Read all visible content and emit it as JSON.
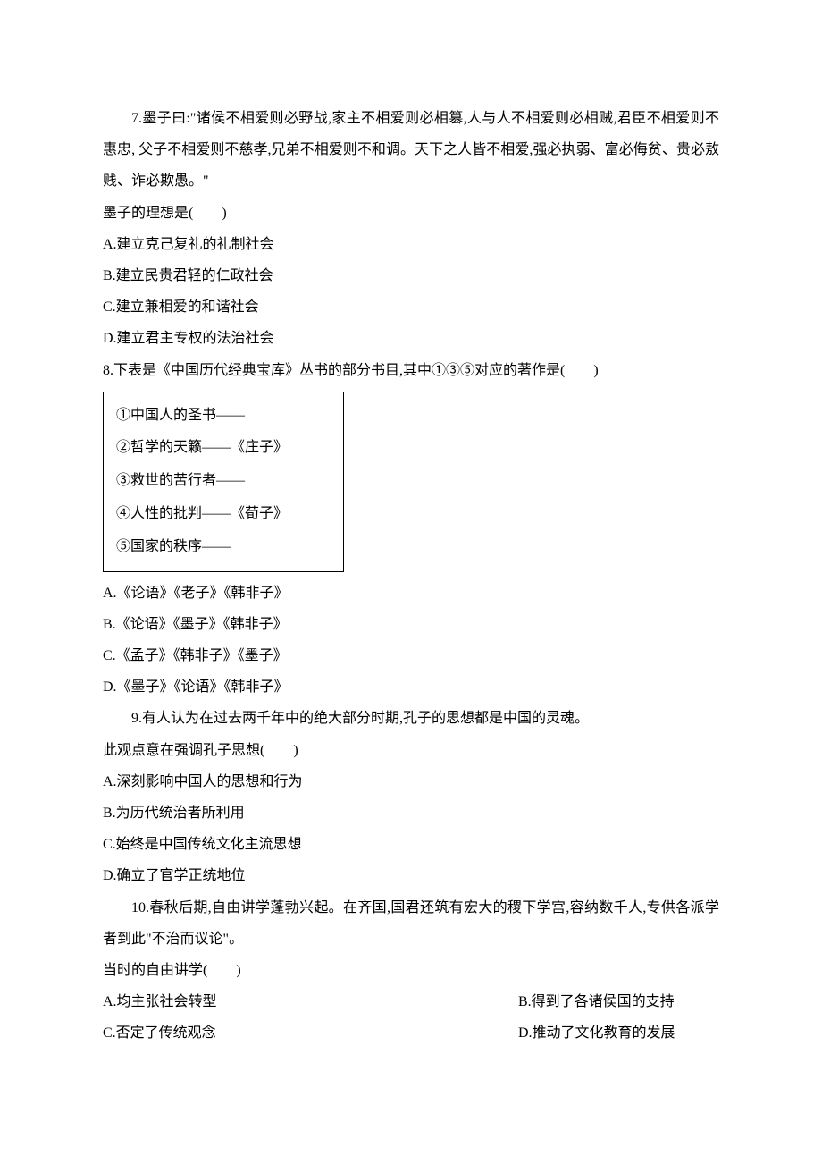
{
  "q7": {
    "text": "7.墨子曰:\"诸侯不相爱则必野战,家主不相爱则必相篡,人与人不相爱则必相贼,君臣不相爱则不惠忠, 父子不相爱则不慈孝,兄弟不相爱则不和调。天下之人皆不相爱,强必执弱、富必侮贫、贵必敖贱、诈必欺愚。\"",
    "stem": "墨子的理想是(　　)",
    "A": "A.建立克己复礼的礼制社会",
    "B": "B.建立民贵君轻的仁政社会",
    "C": "C.建立兼相爱的和谐社会",
    "D": "D.建立君主专权的法治社会"
  },
  "q8": {
    "text": "8.下表是《中国历代经典宝库》丛书的部分书目,其中①③⑤对应的著作是(　　)",
    "box": {
      "l1": "①中国人的圣书——",
      "l2": "②哲学的天籁——《庄子》",
      "l3": "③救世的苦行者——",
      "l4": "④人性的批判——《荀子》",
      "l5": "⑤国家的秩序——"
    },
    "A": "A.《论语》《老子》《韩非子》",
    "B": "B.《论语》《墨子》《韩非子》",
    "C": "C.《孟子》《韩非子》《墨子》",
    "D": "D.《墨子》《论语》《韩非子》"
  },
  "q9": {
    "text": "9.有人认为在过去两千年中的绝大部分时期,孔子的思想都是中国的灵魂。",
    "stem": "此观点意在强调孔子思想(　　)",
    "A": "A.深刻影响中国人的思想和行为",
    "B": "B.为历代统治者所利用",
    "C": "C.始终是中国传统文化主流思想",
    "D": "D.确立了官学正统地位"
  },
  "q10": {
    "text": "10.春秋后期,自由讲学蓬勃兴起。在齐国,国君还筑有宏大的稷下学宫,容纳数千人,专供各派学者到此\"不治而议论\"。",
    "stem": "当时的自由讲学(　　)",
    "A": "A.均主张社会转型",
    "B": "B.得到了各诸侯国的支持",
    "C": "C.否定了传统观念",
    "D": "D.推动了文化教育的发展"
  }
}
